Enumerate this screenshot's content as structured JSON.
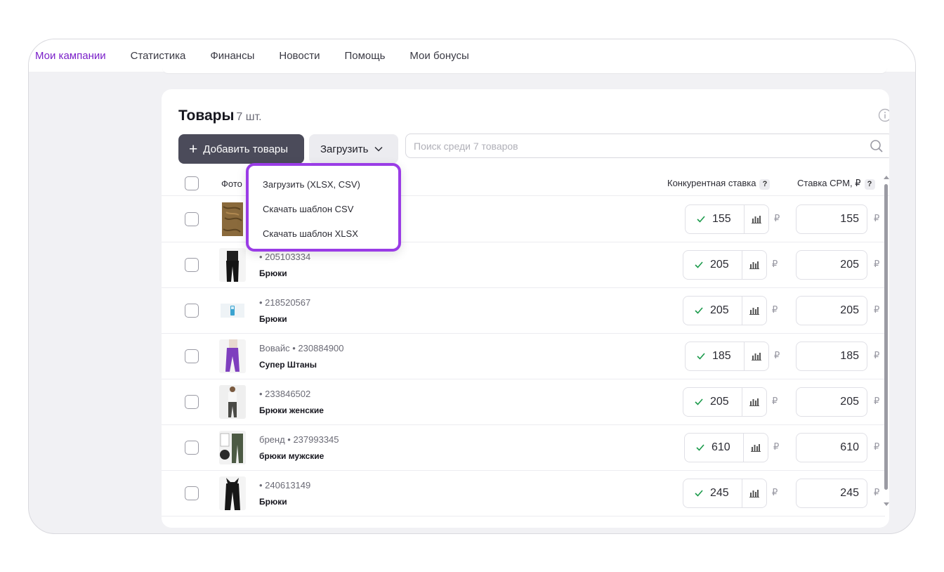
{
  "nav": {
    "items": [
      {
        "label": "Мои кампании",
        "active": true
      },
      {
        "label": "Статистика"
      },
      {
        "label": "Финансы"
      },
      {
        "label": "Новости"
      },
      {
        "label": "Помощь"
      },
      {
        "label": "Мои бонусы"
      }
    ]
  },
  "colors": {
    "accent": "#7a1fc9",
    "highlight_border": "#9a3ce6",
    "primary_button": "#4b4b5a",
    "check": "#1a9a4a"
  },
  "products": {
    "title": "Товары",
    "count": "7 шт.",
    "add_button": "Добавить товары",
    "upload_button": "Загрузить",
    "search_placeholder": "Поиск среди 7 товаров",
    "icons": {
      "info": "info-icon",
      "search": "search-icon",
      "chevron": "chevron-down-icon",
      "plus": "plus-icon",
      "bar_chart": "bar-chart-icon",
      "check": "check-icon"
    },
    "columns": {
      "photo": "Фото",
      "competitive_bid": "Конкурентная ставка",
      "cpm_bid": "Ставка CPM, ₽",
      "help": "?"
    },
    "currency": "₽",
    "dropdown": {
      "items": [
        "Загрузить (XLSX, CSV)",
        "Скачать шаблон CSV",
        "Скачать шаблон XLSX"
      ]
    },
    "rows": [
      {
        "brand": "",
        "sku": "",
        "name": "",
        "competitive_bid": "155",
        "cpm": "155"
      },
      {
        "brand": "",
        "sku": "205103334",
        "name": "Брюки",
        "competitive_bid": "205",
        "cpm": "205"
      },
      {
        "brand": "",
        "sku": "218520567",
        "name": "Брюки",
        "competitive_bid": "205",
        "cpm": "205"
      },
      {
        "brand": "Вовайс",
        "sku": "230884900",
        "name": "Супер Штаны",
        "competitive_bid": "185",
        "cpm": "185"
      },
      {
        "brand": "",
        "sku": "233846502",
        "name": "Брюки женские",
        "competitive_bid": "205",
        "cpm": "205"
      },
      {
        "brand": "бренд",
        "sku": "237993345",
        "name": "брюки мужские",
        "competitive_bid": "610",
        "cpm": "610"
      },
      {
        "brand": "",
        "sku": "240613149",
        "name": "Брюки",
        "competitive_bid": "245",
        "cpm": "245"
      }
    ]
  }
}
